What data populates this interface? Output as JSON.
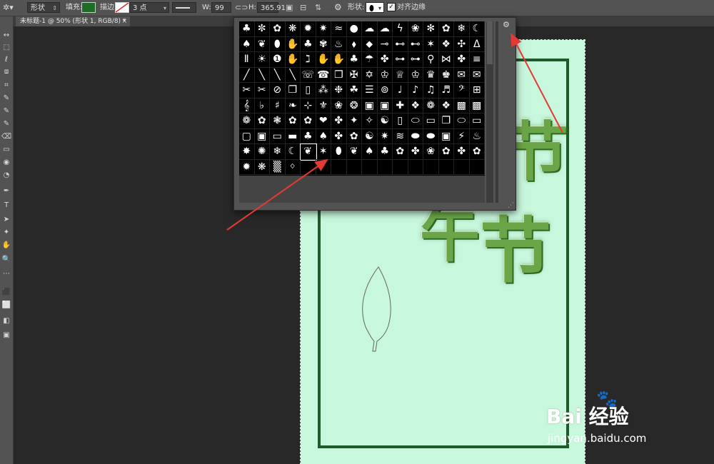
{
  "options_bar": {
    "tool_icon": "custom-shape-tool-icon",
    "mode": "形状",
    "fill_label": "填充:",
    "stroke_label": "描边:",
    "stroke_width": "3 点",
    "w_label": "W:",
    "w_value": "99 像素",
    "link_icon": "link-icon",
    "h_label": "H:",
    "h_value": "365.91",
    "shape_label": "形状:",
    "align_edges_label": "对齐边缘",
    "fill_color": "#1f6b2a",
    "stroke_color": "#ffffff"
  },
  "document_tab": {
    "title": "未标题-1 @ 50% (形状 1, RGB/8) *",
    "close": "×"
  },
  "toolbar": {
    "tools": [
      "↔",
      "⬚",
      "ℓ",
      "⧈",
      "⌗",
      "✎",
      "✎",
      "✎",
      "⌫",
      "▭",
      "◉",
      "◔",
      "✒",
      "T",
      "➤",
      "✦",
      "✋",
      "🔍",
      "⋯",
      "⬛",
      "⬜",
      "◧",
      "▣"
    ]
  },
  "shape_picker": {
    "glyphs": [
      "♣",
      "✼",
      "✿",
      "❋",
      "✹",
      "✷",
      "≈",
      "●",
      "☁",
      "☁",
      "ϟ",
      "❀",
      "✻",
      "✿",
      "❄",
      "☾",
      "♠",
      "❦",
      "⬮",
      "✋",
      "♣",
      "✾",
      "♨",
      "⬧",
      "⬥",
      "⊸",
      "⊷",
      "⊷",
      "✶",
      "❖",
      "✣",
      "ᐃ",
      "Ⅱ",
      "☀",
      "❶",
      "✋",
      "ℷ",
      "✋",
      "✋",
      "♣",
      "☂",
      "✤",
      "⊶",
      "⊶",
      "⚲",
      "⋈",
      "✤",
      "≡",
      "╱",
      "╲",
      "╲",
      "╲",
      "☏",
      "☎",
      "❐",
      "✠",
      "✡",
      "♔",
      "♕",
      "♔",
      "♛",
      "♚",
      "✉",
      "✉",
      "✂",
      "✂",
      "⊘",
      "❐",
      "▯",
      "⁂",
      "❉",
      "☘",
      "☰",
      "⊚",
      "♩",
      "♪",
      "♫",
      "♬",
      "𝄢",
      "⊞",
      "𝄞",
      "♭",
      "♯",
      "❧",
      "⊹",
      "⚜",
      "❀",
      "❂",
      "▣",
      "▣",
      "✚",
      "❖",
      "❁",
      "❖",
      "▩",
      "▩",
      "❁",
      "✿",
      "❃",
      "✿",
      "✿",
      "❤",
      "✤",
      "✦",
      "✧",
      "☯",
      "▯",
      "⬭",
      "▭",
      "❐",
      "⬭",
      "▭",
      "▢",
      "▣",
      "▭",
      "▬",
      "♣",
      "♠",
      "✤",
      "✿",
      "☯",
      "✷",
      "≋",
      "⬬",
      "⬬",
      "▣",
      "⚡",
      "♨",
      "✸",
      "✺",
      "❄",
      "☾",
      "❦",
      "✶",
      "⬮",
      "❦",
      "♠",
      "♣",
      "✿",
      "✤",
      "❀",
      "✿",
      "✤",
      "✿",
      "✹",
      "❋",
      "▒",
      "ᛜ",
      "",
      "",
      "",
      "",
      "",
      "",
      "",
      "",
      "",
      "",
      "",
      ""
    ],
    "selected_index": 132,
    "gear_icon": "⚙",
    "resize_icon": "⋰"
  },
  "canvas": {
    "background": "#c7f7dc",
    "frame_color": "#1f5a2a",
    "title_chars": [
      "节",
      "午",
      "节"
    ]
  },
  "watermark": {
    "brand": "Bai  经验",
    "paw": "🐾",
    "url": "jingyan.baidu.com"
  }
}
